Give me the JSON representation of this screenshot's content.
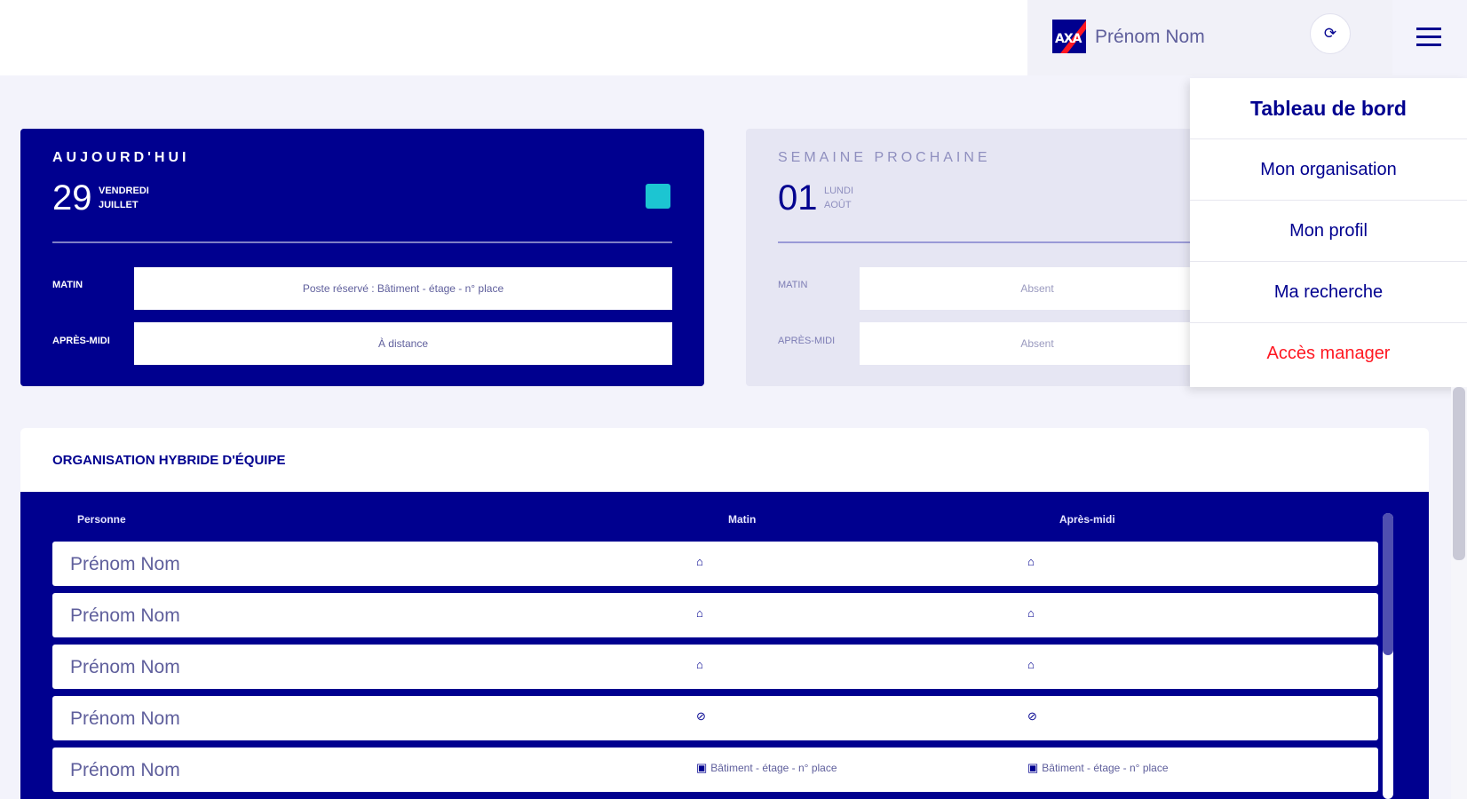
{
  "header": {
    "brand": "AXA",
    "user_name": "Prénom Nom",
    "logout_icon": "logout-icon",
    "menu_icon": "hamburger-menu-icon"
  },
  "today": {
    "title": "AUJOURD'HUI",
    "day_number": "29",
    "weekday": "VENDREDI",
    "month": "JUILLET",
    "morning_label": "MATIN",
    "morning_value": "Poste réservé : Bâtiment - étage - n° place",
    "afternoon_label": "APRÈS-MIDI",
    "afternoon_value": "À distance",
    "status_color": "#1cc5d2"
  },
  "next_week": {
    "title": "SEMAINE PROCHAINE",
    "day_number": "01",
    "weekday": "LUNDI",
    "month": "AOÛT",
    "morning_label": "MATIN",
    "morning_value": "Absent",
    "afternoon_label": "APRÈS-MIDI",
    "afternoon_value": "Absent"
  },
  "menu": {
    "items": [
      {
        "label": "Tableau de bord"
      },
      {
        "label": "Mon organisation"
      },
      {
        "label": "Mon profil"
      },
      {
        "label": "Ma recherche"
      },
      {
        "label": "Accès manager"
      }
    ]
  },
  "team": {
    "title": "ORGANISATION HYBRIDE D'ÉQUIPE",
    "columns": [
      "Personne",
      "Matin",
      "Après-midi"
    ],
    "rows": [
      {
        "name": "Prénom Nom",
        "morning_icon": "home-icon",
        "morning_text": "",
        "afternoon_icon": "home-icon",
        "afternoon_text": ""
      },
      {
        "name": "Prénom Nom",
        "morning_icon": "home-icon",
        "morning_text": "",
        "afternoon_icon": "home-icon",
        "afternoon_text": ""
      },
      {
        "name": "Prénom Nom",
        "morning_icon": "home-icon",
        "morning_text": "",
        "afternoon_icon": "home-icon",
        "afternoon_text": ""
      },
      {
        "name": "Prénom Nom",
        "morning_icon": "absent-icon",
        "morning_text": "",
        "afternoon_icon": "absent-icon",
        "afternoon_text": ""
      },
      {
        "name": "Prénom Nom",
        "morning_icon": "building-icon",
        "morning_text": "Bâtiment - étage - n° place",
        "afternoon_icon": "building-icon",
        "afternoon_text": "Bâtiment - étage - n° place"
      }
    ]
  },
  "colors": {
    "primary": "#00008f",
    "accent_red": "#ff1721",
    "background": "#f3f3fb"
  }
}
